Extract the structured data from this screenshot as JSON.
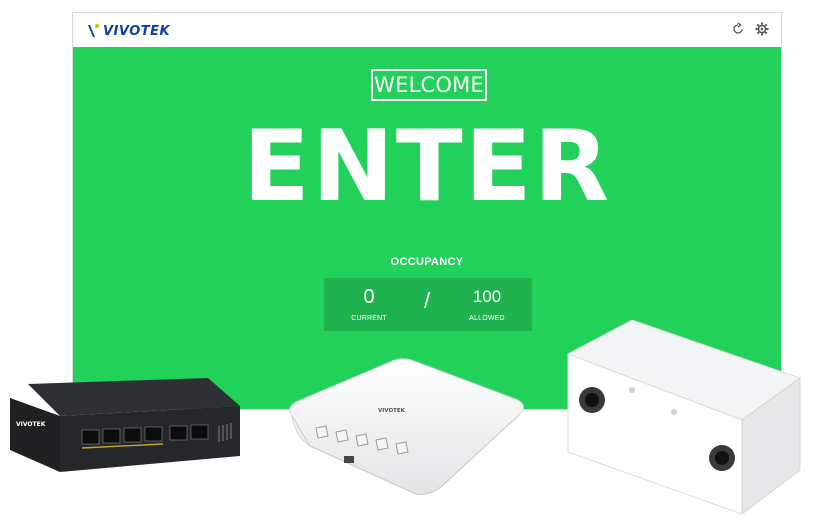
{
  "header": {
    "logo_text": "VIVOTEK"
  },
  "colors": {
    "screen_green": "#22d15a",
    "panel_green": "#1fb24e",
    "brand_blue": "#0b3fa6"
  },
  "icons": {
    "header_left": "refresh-icon",
    "header_right": "gear-icon"
  },
  "main": {
    "welcome_label": "WELCOME",
    "status_text": "ENTER",
    "occupancy_label": "OCCUPANCY",
    "current_value": "0",
    "current_label": "CURRENT",
    "separator": "/",
    "allowed_value": "100",
    "allowed_label": "ALLOWED"
  },
  "devices": {
    "switch_logo": "VIVOTEK",
    "ap_logo": "VIVOTEK"
  }
}
